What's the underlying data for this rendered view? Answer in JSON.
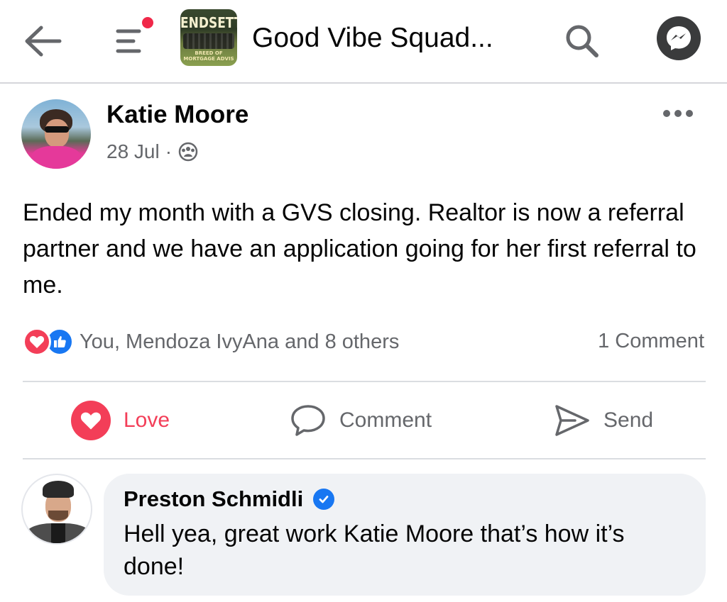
{
  "header": {
    "group_title": "Good Vibe Squad...",
    "thumbnail_text": "ENDSETT",
    "thumbnail_subtext": "BREED OF MORTGAGE ADVIS",
    "icons": {
      "back": "back-arrow-icon",
      "menu": "menu-icon",
      "search": "search-icon",
      "messenger": "messenger-icon"
    },
    "notification_dot_color": "#f02849"
  },
  "post": {
    "author": "Katie Moore",
    "date": "28 Jul",
    "separator": "·",
    "audience_icon": "group-audience-icon",
    "body": "Ended my month with a GVS closing. Realtor is now a referral partner and we have an application going for her first referral to me.",
    "reactions": {
      "icons": [
        "love-reaction-icon",
        "like-reaction-icon"
      ],
      "summary": "You, Mendoza IvyAna and 8 others"
    },
    "comment_count": "1 Comment"
  },
  "actions": {
    "love": "Love",
    "comment": "Comment",
    "send": "Send"
  },
  "comment": {
    "author": "Preston Schmidli",
    "verified_icon": "verified-badge-icon",
    "text": "Hell yea, great work Katie Moore that’s how it’s done!"
  },
  "colors": {
    "love": "#f33e58",
    "like": "#1877f2",
    "secondary_text": "#65676b",
    "bubble": "#f0f2f5"
  }
}
